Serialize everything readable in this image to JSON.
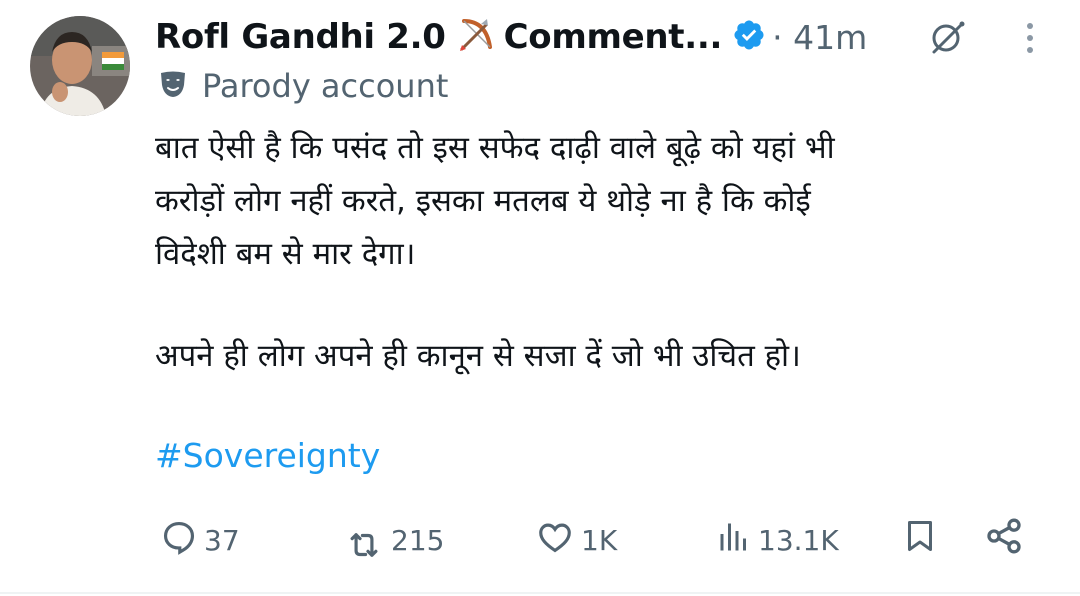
{
  "tweet": {
    "author": {
      "display_name": "Rofl Gandhi 2.0",
      "name_suffix": "Comment...",
      "emoji": "bow-and-arrow-emoji",
      "verified": true,
      "verified_color": "#1d9bf0",
      "time": "· 41m",
      "label_icon": "parody-mask-icon",
      "label": "Parody account"
    },
    "body": {
      "line1": "बात ऐसी है कि पसंद तो इस सफेद दाढ़ी वाले बूढ़े को यहां भी",
      "line2": "करोड़ों लोग नहीं करते, इसका मतलब ये थोड़े ना है कि कोई",
      "line3": "विदेशी बम से मार देगा।",
      "line4": "अपने ही लोग अपने ही कानून से सजा दें जो भी उचित हो।"
    },
    "hashtag": "#Sovereignty",
    "hashtag_color": "#1d9bf0",
    "actions": {
      "replies": "37",
      "reposts": "215",
      "likes": "1K",
      "views": "13.1K"
    },
    "icons": [
      "grok-icon",
      "more-icon",
      "reply-icon",
      "repost-icon",
      "like-icon",
      "views-icon",
      "bookmark-icon",
      "share-icon"
    ]
  }
}
